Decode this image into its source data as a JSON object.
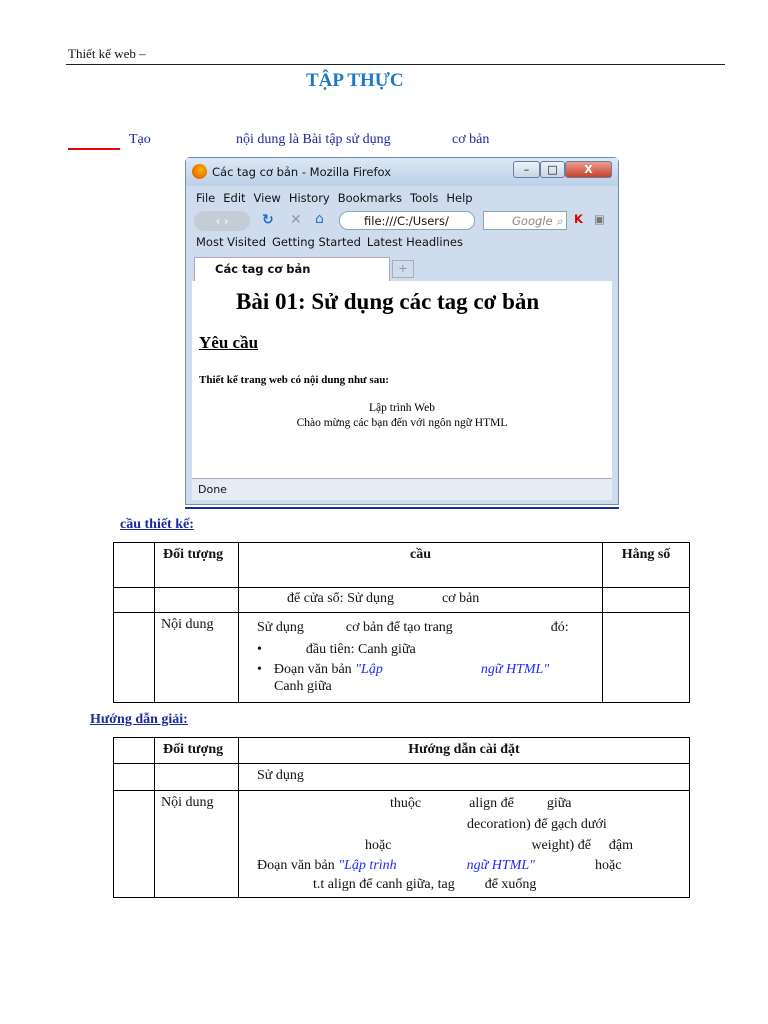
{
  "header": {
    "text": "Thiết kế web –"
  },
  "title": "TẬP THỰC",
  "intro": {
    "a": "Tạo",
    "b": "nội dung là Bài tập sử dụng",
    "c": "cơ bản"
  },
  "browser": {
    "window_title": "Các tag cơ bản - Mozilla Firefox",
    "menu": [
      "File",
      "Edit",
      "View",
      "History",
      "Bookmarks",
      "Tools",
      "Help"
    ],
    "url": "file:///C:/Users/",
    "search_placeholder": "Google",
    "bookmarks": [
      "Most Visited",
      "Getting Started",
      "Latest Headlines"
    ],
    "tab": "Các tag cơ bản",
    "page": {
      "h1": "Bài 01: Sử dụng các tag cơ bản",
      "h2": "Yêu cầu",
      "p": "Thiết kế trang web có nội dung như sau:",
      "line1": "Lập trình Web",
      "line2": "Chào mừng các bạn đến với ngôn ngữ HTML"
    },
    "status": "Done"
  },
  "section1": {
    "heading": "cầu thiết kế:",
    "headers": [
      "Đối tượng",
      "cầu",
      "Hằng số"
    ],
    "row1": "để cửa sổ: Sử dụng",
    "row1b": "cơ bản",
    "row2": {
      "obj": "Nội dung",
      "l1a": "Sử dụng",
      "l1b": "cơ bản để tạo trang",
      "l1c": "đó:",
      "b1": "đầu tiên: Canh giữa",
      "b2a": "Đoạn văn bản",
      "b2b": "\"Lập",
      "b2c": "ngữ HTML\"",
      "b2d": "Canh giữa"
    }
  },
  "section2": {
    "heading": "Hướng dẫn giải:",
    "headers": [
      "Đối tượng",
      "Hướng dẫn cài đặt"
    ],
    "row1": "Sử dụng",
    "row2": {
      "obj": "Nội dung",
      "l1a": "thuộc",
      "l1b": "align để",
      "l1c": "giữa",
      "l2": "decoration) để gạch dưới",
      "l3a": "hoặc",
      "l3b": "weight) để",
      "l3c": "đậm",
      "l4a": "Đoạn văn bản",
      "l4b": "\"Lập trình",
      "l4c": "ngữ HTML\"",
      "l4d": "hoặc",
      "l5a": "t.t align để canh giữa, tag",
      "l5b": "để xuống"
    }
  }
}
